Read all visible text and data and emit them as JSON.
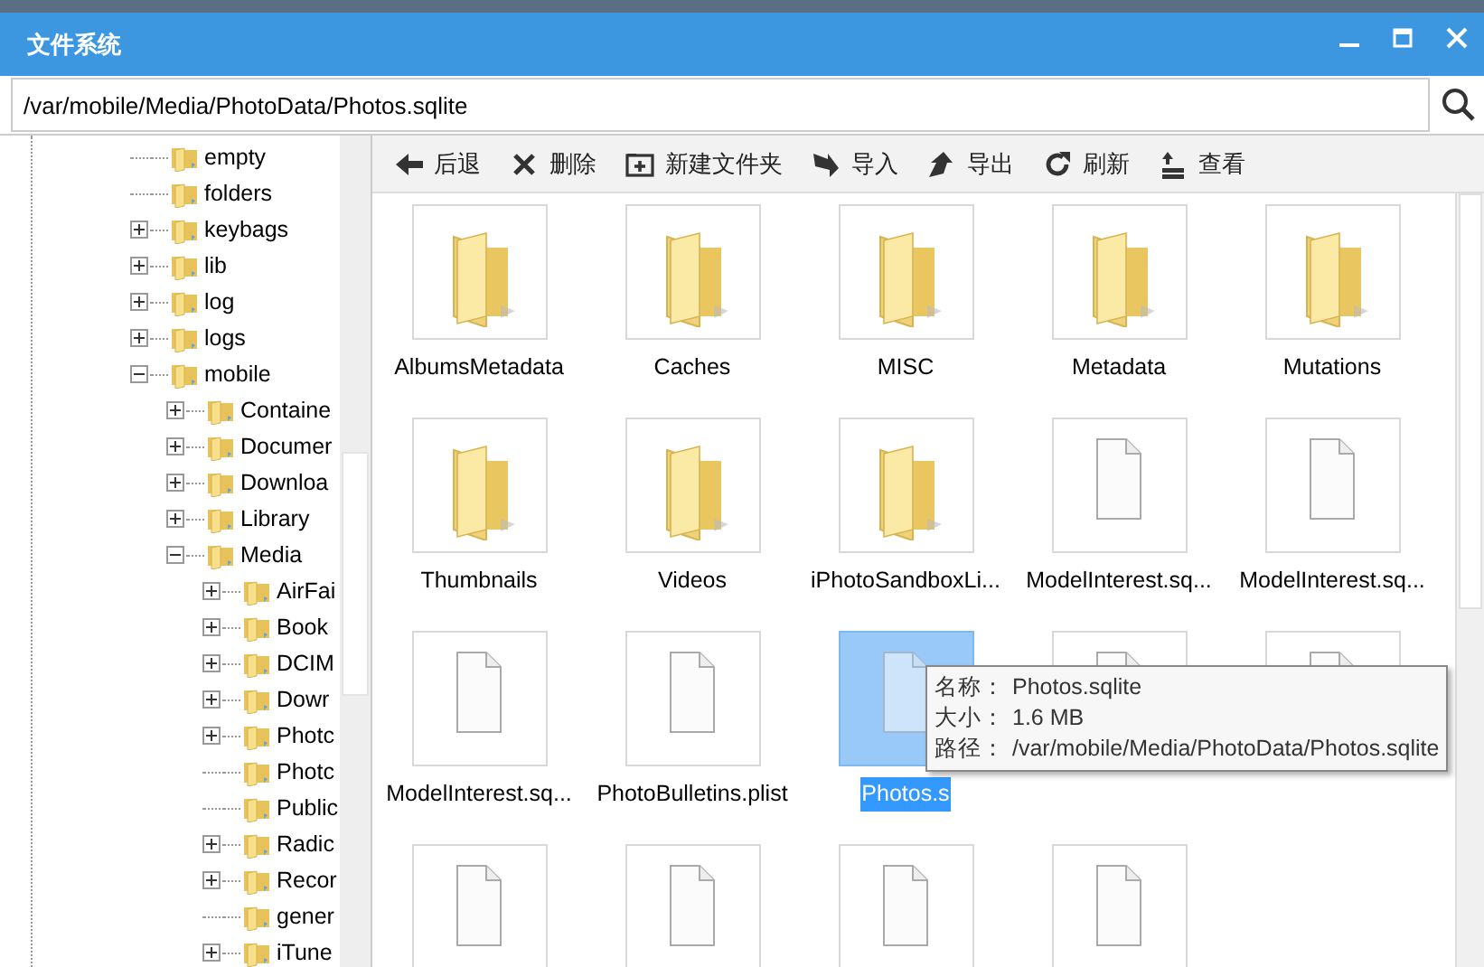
{
  "window": {
    "title": "文件系统"
  },
  "path_bar": {
    "value": "/var/mobile/Media/PhotoData/Photos.sqlite"
  },
  "tree": [
    {
      "label": "empty"
    },
    {
      "label": "folders"
    },
    {
      "label": "keybags",
      "expanded": false
    },
    {
      "label": "lib",
      "expanded": false
    },
    {
      "label": "log",
      "expanded": false
    },
    {
      "label": "logs",
      "expanded": false
    },
    {
      "label": "mobile",
      "expanded": true,
      "children": [
        {
          "label": "Containe",
          "expanded": false
        },
        {
          "label": "Documer",
          "expanded": false
        },
        {
          "label": "Downloa",
          "expanded": false
        },
        {
          "label": "Library",
          "expanded": false
        },
        {
          "label": "Media",
          "expanded": true,
          "children": [
            {
              "label": "AirFai",
              "expanded": false
            },
            {
              "label": "Book",
              "expanded": false
            },
            {
              "label": "DCIM",
              "expanded": false
            },
            {
              "label": "Dowr",
              "expanded": false
            },
            {
              "label": "Photc",
              "expanded": false
            },
            {
              "label": "Photc"
            },
            {
              "label": "Public"
            },
            {
              "label": "Radic",
              "expanded": false
            },
            {
              "label": "Recor",
              "expanded": false
            },
            {
              "label": "gener"
            },
            {
              "label": "iTune",
              "expanded": false
            }
          ]
        }
      ]
    }
  ],
  "toolbar": [
    {
      "kind": "back",
      "label": "后退"
    },
    {
      "kind": "delete",
      "label": "删除"
    },
    {
      "kind": "newfolder",
      "label": "新建文件夹"
    },
    {
      "kind": "import",
      "label": "导入"
    },
    {
      "kind": "export",
      "label": "导出"
    },
    {
      "kind": "refresh",
      "label": "刷新"
    },
    {
      "kind": "view",
      "label": "查看"
    }
  ],
  "items": [
    {
      "kind": "folder",
      "label": "AlbumsMetadata",
      "selected": false
    },
    {
      "kind": "folder",
      "label": "Caches",
      "selected": false
    },
    {
      "kind": "folder",
      "label": "MISC",
      "selected": false
    },
    {
      "kind": "folder",
      "label": "Metadata",
      "selected": false
    },
    {
      "kind": "folder",
      "label": "Mutations",
      "selected": false
    },
    {
      "kind": "folder",
      "label": "Thumbnails",
      "selected": false
    },
    {
      "kind": "folder",
      "label": "Videos",
      "selected": false
    },
    {
      "kind": "folder",
      "label": "iPhotoSandboxLi...",
      "selected": false
    },
    {
      "kind": "file",
      "label": "ModelInterest.sq...",
      "selected": false
    },
    {
      "kind": "file",
      "label": "ModelInterest.sq...",
      "selected": false
    },
    {
      "kind": "file",
      "label": "ModelInterest.sq...",
      "selected": false
    },
    {
      "kind": "file",
      "label": "PhotoBulletins.plist",
      "selected": false
    },
    {
      "kind": "file",
      "label": "Photos.s",
      "selected": true
    },
    {
      "kind": "file",
      "selected": false
    },
    {
      "kind": "file",
      "selected": false
    },
    {
      "kind": "file",
      "selected": false
    },
    {
      "kind": "file",
      "selected": false
    },
    {
      "kind": "file",
      "selected": false
    },
    {
      "kind": "file",
      "selected": false
    }
  ],
  "tooltip": [
    {
      "key": "名称：",
      "value": "Photos.sqlite"
    },
    {
      "key": "大小：",
      "value": "1.6 MB"
    },
    {
      "key": "路径：",
      "value": "/var/mobile/Media/PhotoData/Photos.sqlite"
    }
  ]
}
